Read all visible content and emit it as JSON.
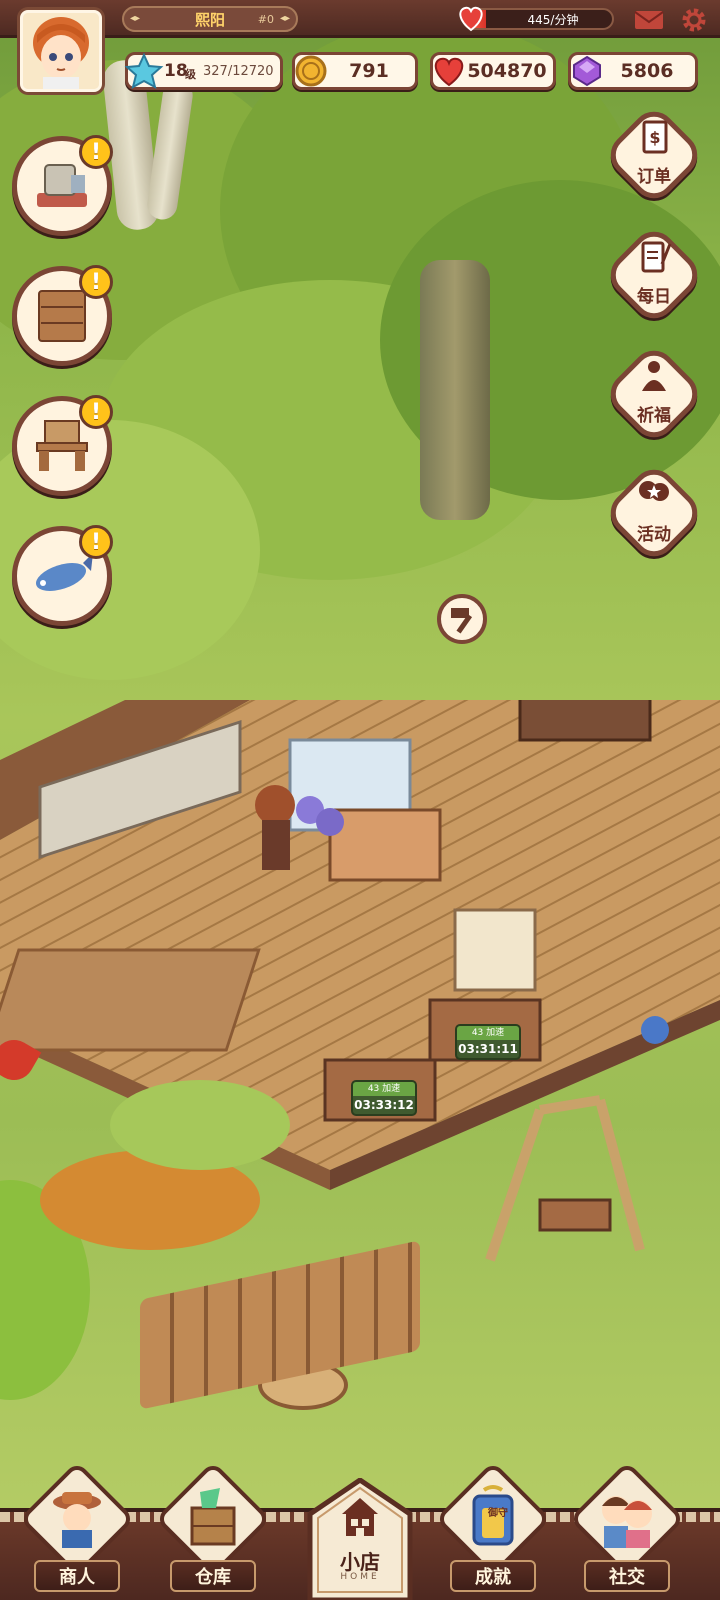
{
  "player": {
    "name": "熙阳",
    "id_tag": "#0",
    "level": "18",
    "level_unit": "级",
    "exp": "327/12720"
  },
  "income": {
    "rate_text": "445/分钟",
    "fill_fraction": 0.15
  },
  "currency": {
    "coins": "791",
    "hearts": "504870",
    "gems": "5806"
  },
  "task_buttons": [
    {
      "name": "sewing-machine-task",
      "alert": "!"
    },
    {
      "name": "cabinet-task",
      "alert": "!"
    },
    {
      "name": "desk-task",
      "alert": "!"
    },
    {
      "name": "fish-task",
      "alert": "!"
    }
  ],
  "right_menu": {
    "orders": "订单",
    "daily": "每日",
    "blessing": "祈福",
    "events": "活动"
  },
  "timers": [
    {
      "label": "43 加速",
      "value": "03:31:11"
    },
    {
      "label": "43 加速",
      "value": "03:33:12"
    }
  ],
  "bottom_nav": {
    "merchant": "商人",
    "warehouse": "仓库",
    "shop": "小店",
    "shop_sub": "HOME",
    "achievements": "成就",
    "achievements_badge": "御守",
    "social": "社交"
  },
  "colors": {
    "frame_brown": "#7b4535",
    "panel_cream": "#fff7e8",
    "name_gold": "#ffd36a",
    "alert_yellow": "#ffc21a",
    "timer_green": "#6aa544"
  }
}
